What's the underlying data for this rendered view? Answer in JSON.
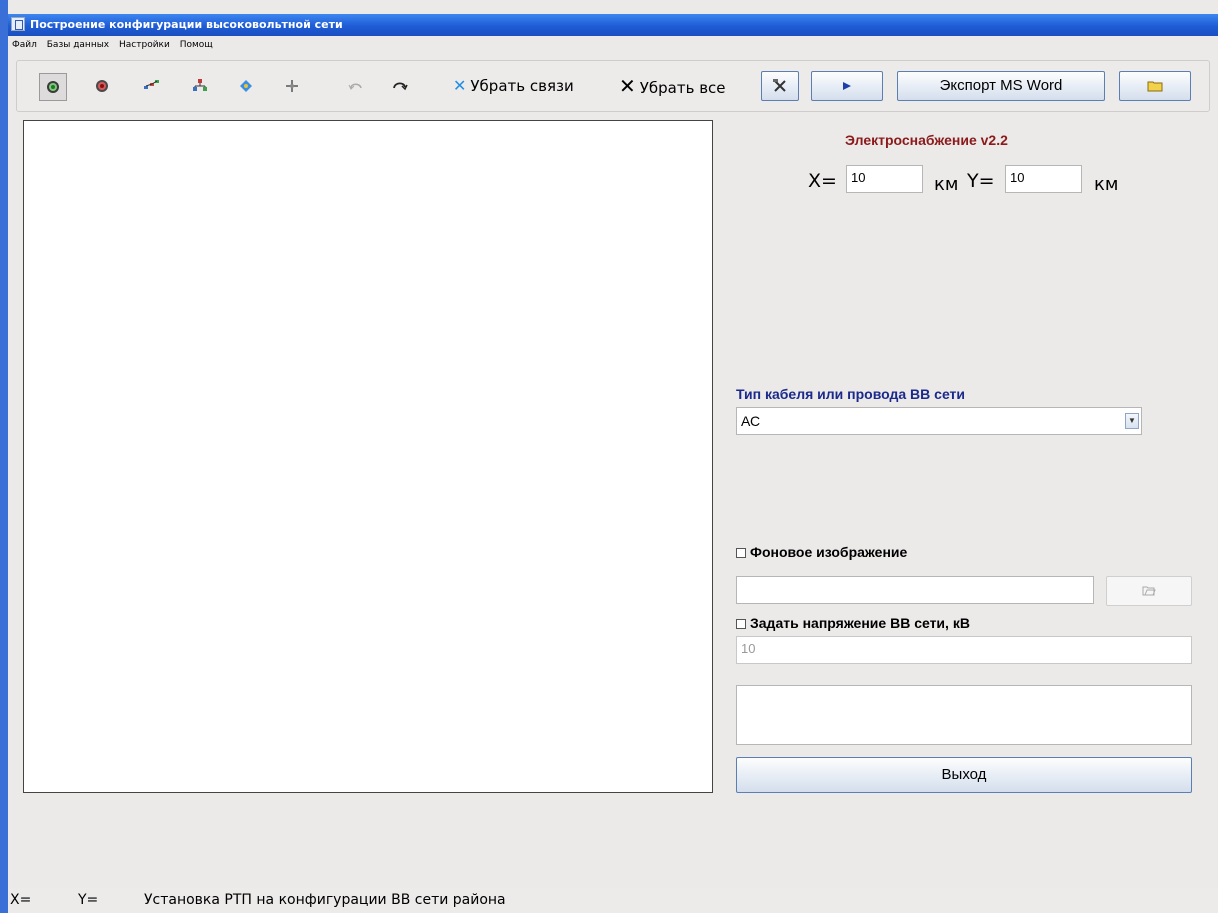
{
  "window": {
    "title": "Построение конфигурации высоковольтной сети"
  },
  "menu": [
    "Файл",
    "Базы данных",
    "Настройки",
    "Помощ"
  ],
  "toolbar": {
    "icons": [
      "target-green-icon",
      "target-red-icon",
      "network-icon",
      "tree-icon",
      "node-icon",
      "move-icon",
      "undo-icon",
      "redo-icon"
    ],
    "remove_links_label": "Убрать связи",
    "remove_all_label": "Убрать все",
    "export_label": "Экспорт MS Word"
  },
  "panel": {
    "version_title": "Электроснабжение v2.2",
    "x_label": "X=",
    "x_value": "10",
    "unit1": "км",
    "y_label": "Y=",
    "y_value": "10",
    "unit2": "км",
    "cable_label": "Тип кабеля или провода ВВ сети",
    "cable_value": "АС",
    "background_label": "Фоновое изображение",
    "background_path": "",
    "voltage_label": "Задать напряжение ВВ сети, кВ",
    "voltage_value": "10",
    "notes_value": "",
    "exit_label": "Выход"
  },
  "status": {
    "x_label": "X=",
    "y_label": "Y=",
    "message": "Установка РТП на конфигурации ВВ сети района"
  },
  "colors": {
    "title_bar": "#1E5CD6",
    "version_title": "#8B1A1A",
    "cable_label": "#1A2A8C",
    "remove_links_icon": "#1F8FE6"
  }
}
